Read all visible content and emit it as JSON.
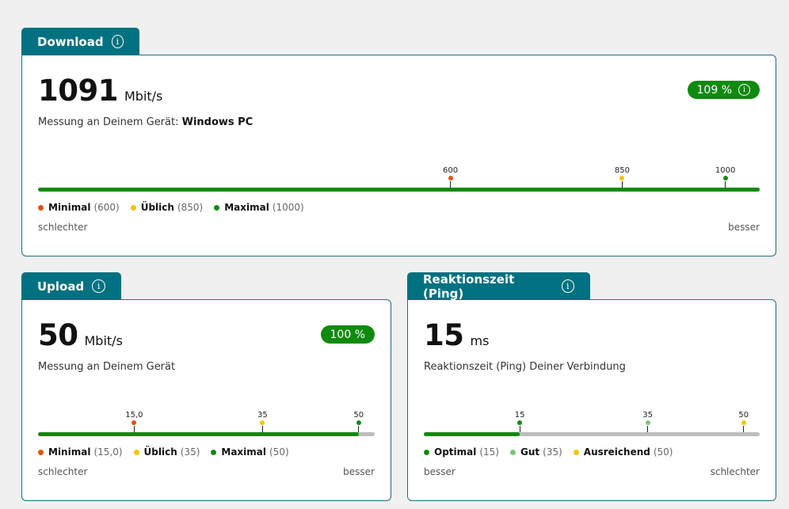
{
  "colors": {
    "teal": "#007180",
    "green": "#0f8a0f",
    "orange": "#e35205",
    "yellow": "#f5c500",
    "lightgreen": "#7cc47c",
    "gray": "#bdbdbd"
  },
  "download": {
    "title": "Download",
    "info_icon": "info-icon",
    "value": "1091",
    "unit": "Mbit/s",
    "subtitle_prefix": "Messung an Deinem Gerät:",
    "subtitle_device": "Windows PC",
    "badge": "109 %",
    "bar_max": 1050,
    "bar_value": 1091,
    "markers": [
      {
        "label": "600",
        "value": 600,
        "color": "#e35205"
      },
      {
        "label": "850",
        "value": 850,
        "color": "#f5c500"
      },
      {
        "label": "1000",
        "value": 1000,
        "color": "#0f8a0f"
      }
    ],
    "legend": [
      {
        "name": "Minimal",
        "value": "(600)",
        "color": "#e35205"
      },
      {
        "name": "Üblich",
        "value": "(850)",
        "color": "#f5c500"
      },
      {
        "name": "Maximal",
        "value": "(1000)",
        "color": "#0f8a0f"
      }
    ],
    "foot_left": "schlechter",
    "foot_right": "besser"
  },
  "upload": {
    "title": "Upload",
    "value": "50",
    "unit": "Mbit/s",
    "subtitle": "Messung an Deinem Gerät",
    "badge": "100 %",
    "bar_max": 52.5,
    "bar_value": 50,
    "markers": [
      {
        "label": "15,0",
        "value": 15,
        "color": "#e35205"
      },
      {
        "label": "35",
        "value": 35,
        "color": "#f5c500"
      },
      {
        "label": "50",
        "value": 50,
        "color": "#0f8a0f"
      }
    ],
    "legend": [
      {
        "name": "Minimal",
        "value": "(15,0)",
        "color": "#e35205"
      },
      {
        "name": "Üblich",
        "value": "(35)",
        "color": "#f5c500"
      },
      {
        "name": "Maximal",
        "value": "(50)",
        "color": "#0f8a0f"
      }
    ],
    "foot_left": "schlechter",
    "foot_right": "besser"
  },
  "ping": {
    "title": "Reaktionszeit (Ping)",
    "value": "15",
    "unit": "ms",
    "subtitle": "Reaktionszeit (Ping) Deiner Verbindung",
    "bar_max": 52.5,
    "bar_value": 15,
    "markers": [
      {
        "label": "15",
        "value": 15,
        "color": "#0f8a0f"
      },
      {
        "label": "35",
        "value": 35,
        "color": "#7cc47c"
      },
      {
        "label": "50",
        "value": 50,
        "color": "#f5c500"
      }
    ],
    "legend": [
      {
        "name": "Optimal",
        "value": "(15)",
        "color": "#0f8a0f"
      },
      {
        "name": "Gut",
        "value": "(35)",
        "color": "#7cc47c"
      },
      {
        "name": "Ausreichend",
        "value": "(50)",
        "color": "#f5c500"
      }
    ],
    "foot_left": "besser",
    "foot_right": "schlechter"
  }
}
